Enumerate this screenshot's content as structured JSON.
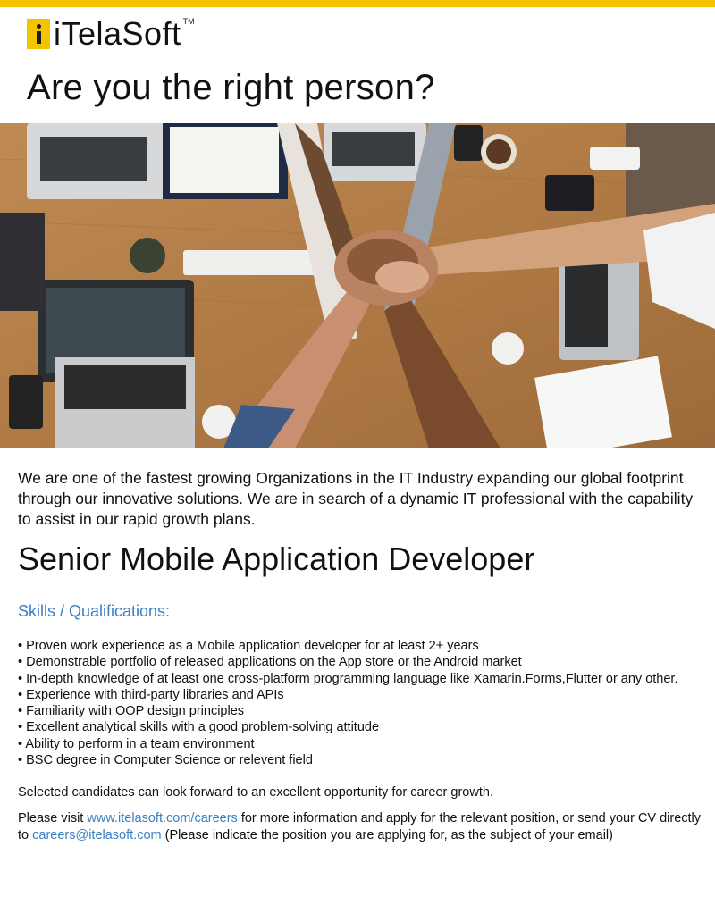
{
  "brand": {
    "name": "iTelaSoft",
    "tm": "TM"
  },
  "headline": "Are you the right person?",
  "intro": "We are one of the fastest growing Organizations in the IT Industry expanding our global footprint through our innovative solutions. We are in search of a dynamic IT professional with the capability to assist in our rapid growth plans.",
  "job_title": "Senior Mobile Application Developer",
  "skills": {
    "heading": "Skills / Qualifications:",
    "items": [
      "Proven work experience as a Mobile application developer for at least 2+ years",
      "Demonstrable portfolio of released applications on the App store or the Android market",
      "In-depth knowledge of at least one cross-platform programming language like Xamarin.Forms,Flutter or any other.",
      "Experience with third-party libraries and APIs",
      "Familiarity with OOP design principles",
      "Excellent analytical skills with a good problem-solving attitude",
      "Ability to perform in a team environment",
      "BSC degree in Computer Science or relevent field"
    ]
  },
  "closing": "Selected candidates can look forward to an excellent opportunity for career growth.",
  "contact": {
    "prefix": "Please visit ",
    "url": "www.itelasoft.com/careers",
    "middle": " for more information and apply for the relevant position, or send your CV directly to ",
    "email": "careers@itelasoft.com",
    "suffix": " (Please indicate the position you are applying for, as the subject of your email)"
  },
  "colors": {
    "accent": "#f5c400",
    "link": "#3c7fc4",
    "table": "#b8834f"
  },
  "hero_image": {
    "icon": "team-hands-photo"
  }
}
